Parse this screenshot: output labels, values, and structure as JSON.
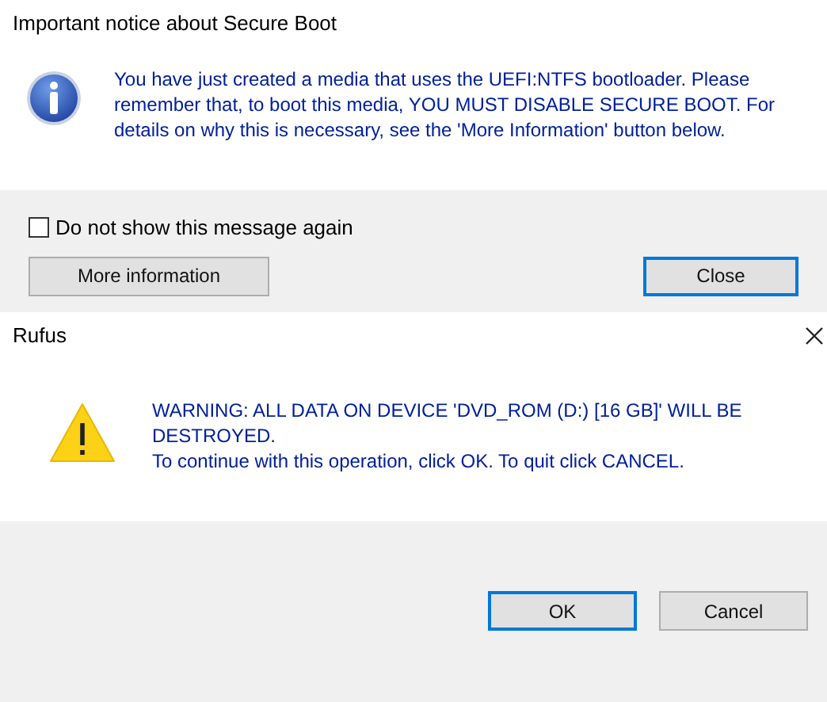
{
  "dialogs": [
    {
      "kind": "notice",
      "title": "Important notice about Secure Boot",
      "message": "You have just created a media that uses the UEFI:NTFS bootloader. Please remember that, to boot this media, YOU MUST DISABLE SECURE BOOT. For details on why this is necessary, see the 'More Information' button below.",
      "checkbox": {
        "label": "Do not show this message again",
        "checked": false
      },
      "buttons": [
        {
          "label": "More information",
          "default": false
        },
        {
          "label": "Close",
          "default": true
        }
      ]
    },
    {
      "kind": "alert",
      "title": "Rufus",
      "message": "WARNING: ALL DATA ON DEVICE 'DVD_ROM (D:) [16 GB]' WILL BE DESTROYED.\nTo continue with this operation, click OK. To quit click CANCEL.",
      "buttons": [
        {
          "label": "OK",
          "default": true
        },
        {
          "label": "Cancel",
          "default": false
        }
      ]
    }
  ]
}
